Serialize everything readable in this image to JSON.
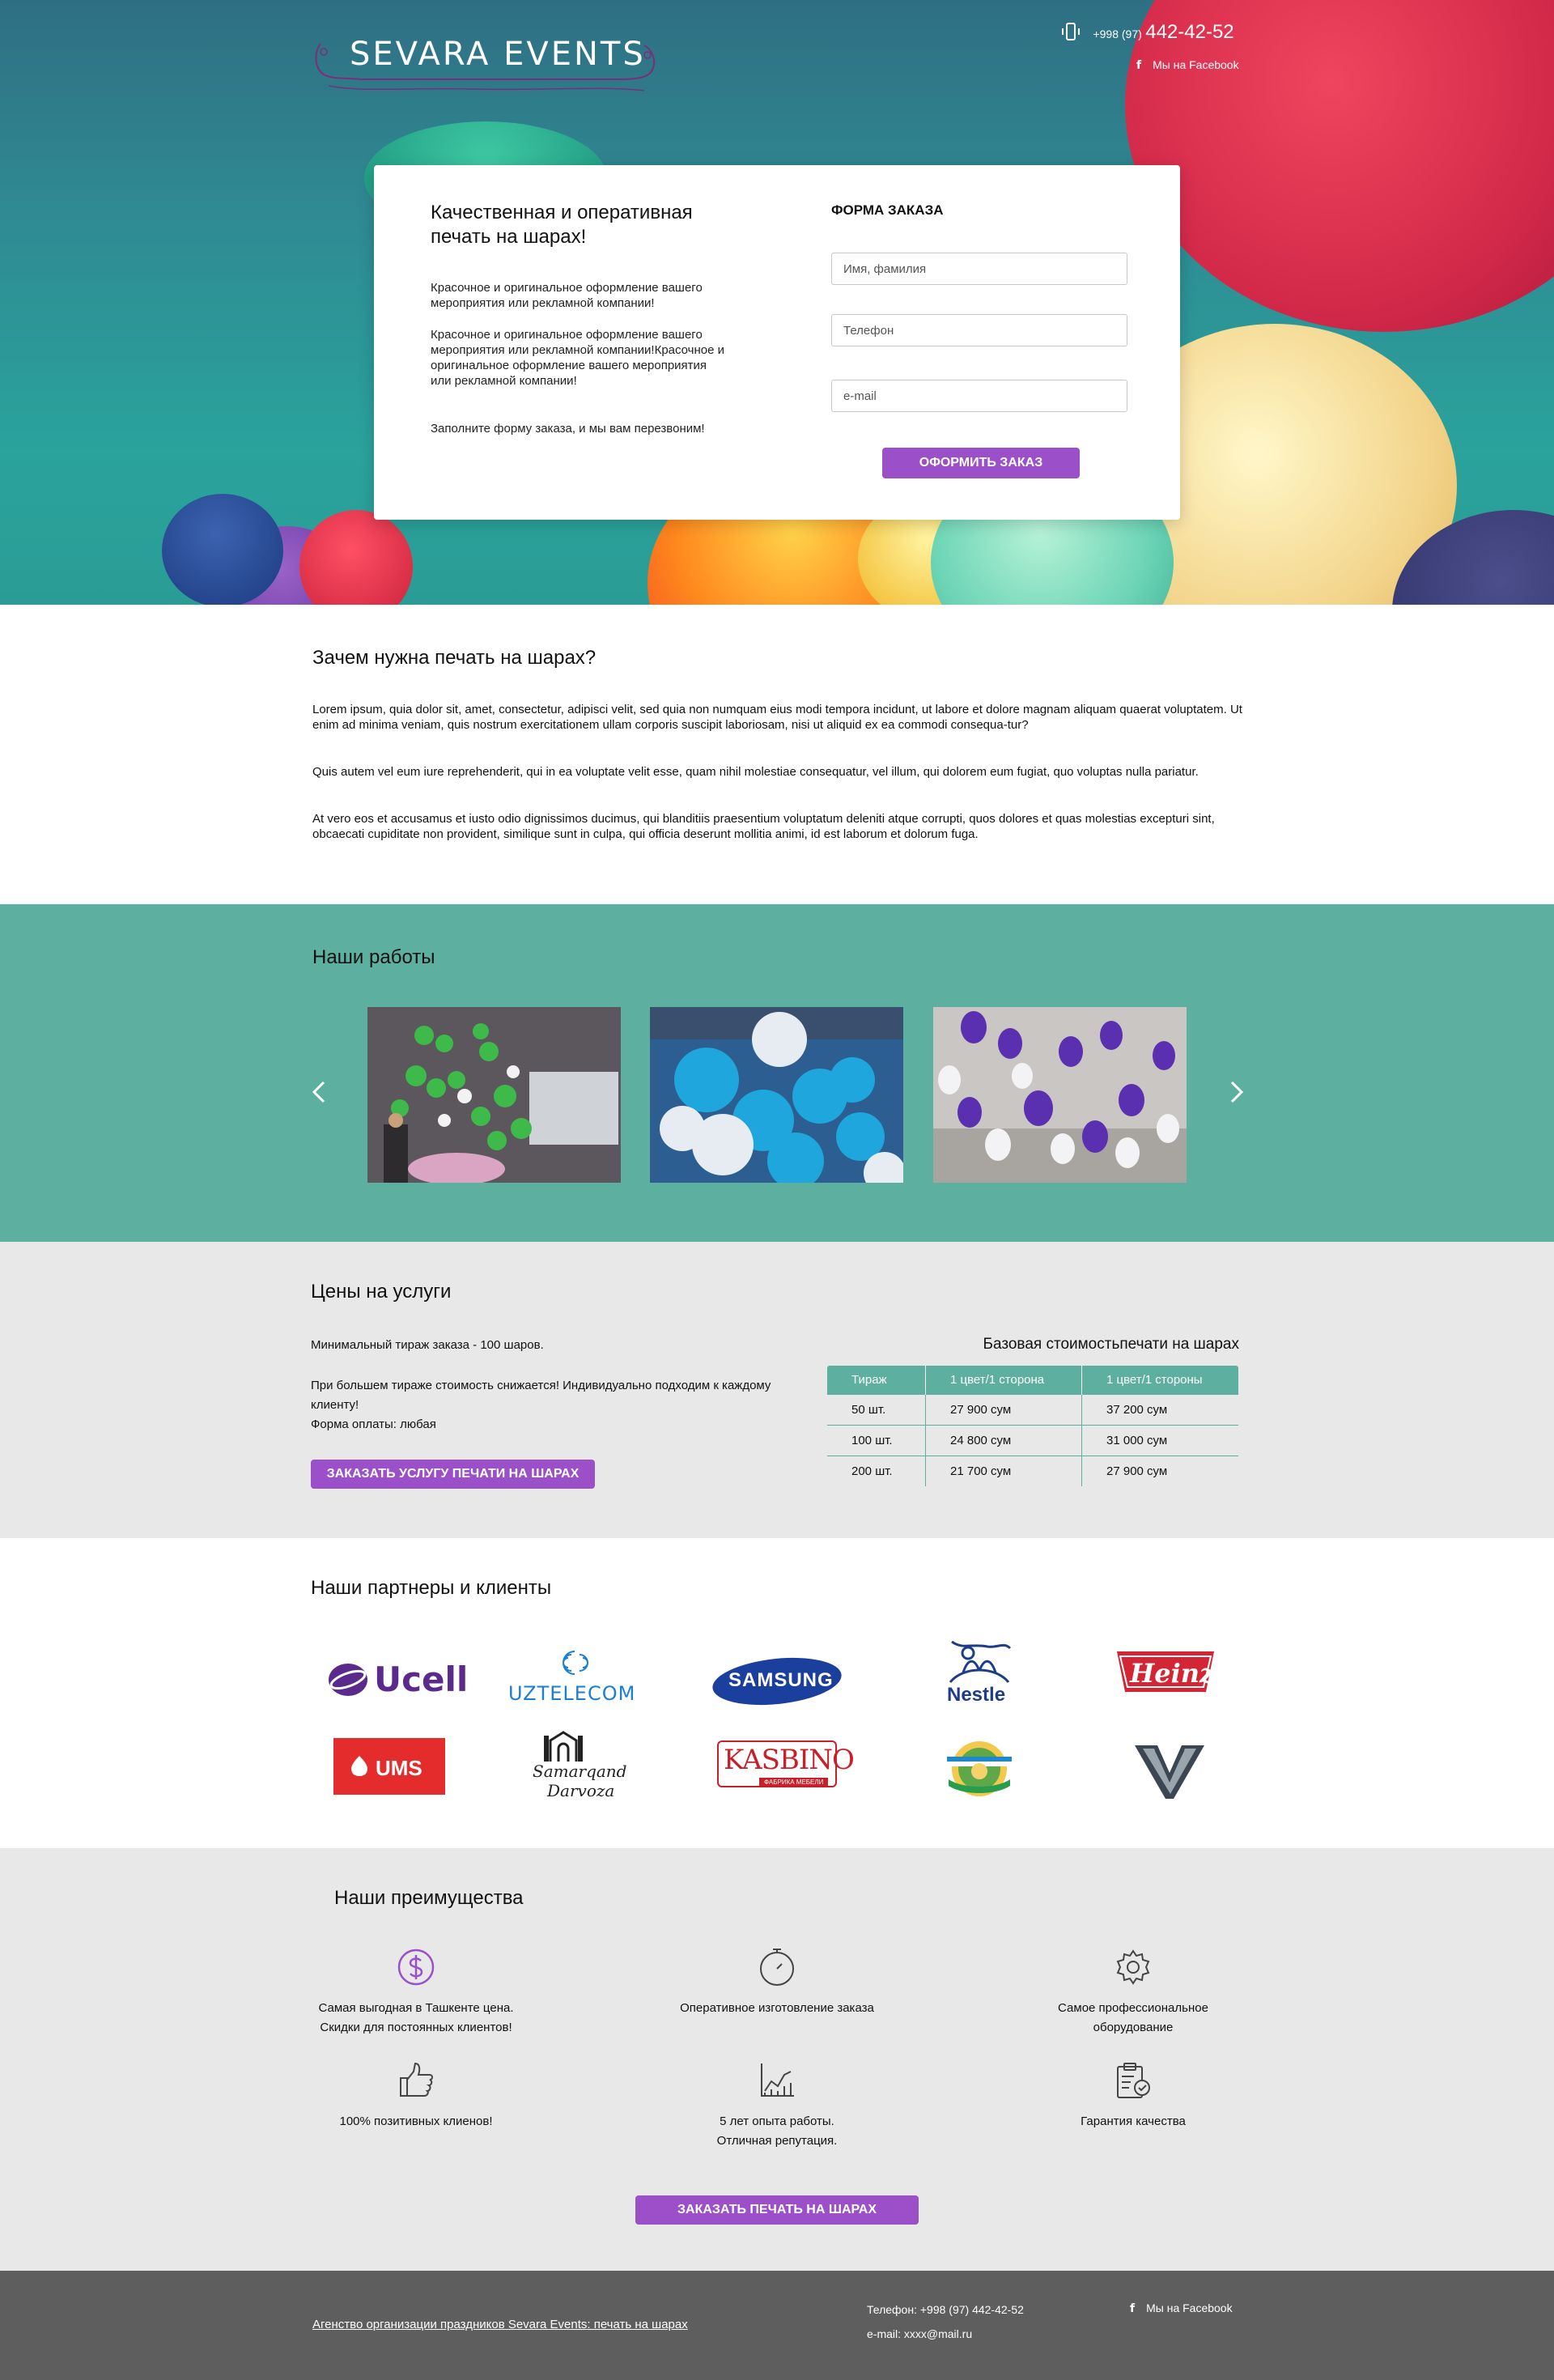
{
  "header": {
    "logo_text": "SEVARA  EVENTS",
    "phone_code": "+998 (97)",
    "phone_number": "442-42-52",
    "facebook_label": "Мы на Facebook"
  },
  "hero": {
    "title": "Качественная и оперативная печать на шарах!",
    "paragraphs": [
      "Красочное и оригинальное оформление вашего мероприятия или рекламной компании!",
      "Красочное и оригинальное оформление вашего мероприятия или рекламной компании!Красочное и оригинальное оформление вашего мероприятия или рекламной компании!",
      "Заполните форму заказа, и мы вам перезвоним!"
    ],
    "form": {
      "title": "ФОРМА ЗАКАЗА",
      "name_placeholder": "Имя, фамилия",
      "phone_placeholder": "Телефон",
      "email_placeholder": "e-mail",
      "submit_label": "ОФОРМИТЬ ЗАКАЗ"
    }
  },
  "why": {
    "title": "Зачем нужна печать на шарах?",
    "paragraphs": [
      "Lorem ipsum, quia dolor sit, amet, consectetur, adipisci velit, sed quia non numquam eius modi tempora incidunt, ut labore et dolore magnam aliquam quaerat voluptatem. Ut enim ad minima veniam, quis nostrum exercitationem ullam corporis suscipit laboriosam, nisi ut aliquid ex ea commodi consequa-tur?",
      "Quis autem vel eum iure reprehenderit, qui in ea voluptate velit esse, quam nihil molestiae consequatur, vel illum, qui dolorem eum fugiat, quo voluptas nulla pariatur.",
      "At vero eos et accusamus et iusto odio dignissimos ducimus, qui blanditiis praesentium voluptatum deleniti atque corrupti, quos dolores et quas molestias excepturi sint, obcaecati cupiditate non provident, similique sunt in culpa, qui officia deserunt mollitia animi, id est laborum et dolorum fuga."
    ]
  },
  "works": {
    "title": "Наши работы",
    "prev_icon": "chevron-left-icon",
    "next_icon": "chevron-right-icon"
  },
  "prices": {
    "title": "Цены на услуги",
    "min_order": "Минимальный тираж заказа - 100 шаров.",
    "discount_line": "При большем тираже стоимость снижается! Индивидуально подходим к каждому клиенту!",
    "payment": "Форма оплаты: любая",
    "order_button": "ЗАКАЗАТЬ УСЛУГУ ПЕЧАТИ НА ШАРАХ",
    "table_title": "Базовая стоимостьпечати на шарах",
    "columns": [
      "Тираж",
      "1 цвет/1 сторона",
      "1 цвет/1 стороны"
    ],
    "rows": [
      [
        "50 шт.",
        "27 900 сум",
        "37 200 сум"
      ],
      [
        "100 шт.",
        "24 800 сум",
        "31 000 сум"
      ],
      [
        "200 шт.",
        "21 700 сум",
        "27 900 сум"
      ]
    ]
  },
  "partners": {
    "title": "Наши партнеры и клиенты",
    "logos": {
      "ucell": "Ucell",
      "uztelecom": "UZTELECOM",
      "samsung": "SAMSUNG",
      "nestle": "Nestle",
      "heinz": "Heinz",
      "ums": "UMS",
      "samarqand_1": "Samarqand",
      "samarqand_2": "Darvoza",
      "kasbino": "KASBINO",
      "kasbino_sub": "ФАБРИКА МЕБЕЛИ"
    }
  },
  "advantages": {
    "title": "Наши преимущества",
    "items": [
      {
        "icon": "dollar-icon",
        "line1": "Самая выгодная в Ташкенте цена.",
        "line2": "Скидки для постоянных клиентов!"
      },
      {
        "icon": "clock-icon",
        "line1": "Оперативное изготовление заказа",
        "line2": ""
      },
      {
        "icon": "gear-icon",
        "line1": "Самое профессиональное",
        "line2": "оборудование"
      },
      {
        "icon": "thumbs-up-icon",
        "line1": "100% позитивных клиенов!",
        "line2": ""
      },
      {
        "icon": "chart-icon",
        "line1": "5 лет опыта работы.",
        "line2": "Отличная репутация."
      },
      {
        "icon": "clipboard-check-icon",
        "line1": "Гарантия качества",
        "line2": ""
      }
    ],
    "order_button": "ЗАКАЗАТЬ ПЕЧАТЬ НА ШАРАХ"
  },
  "footer": {
    "link_text": "Агенство организации праздников Sevara Events: печать на шарах",
    "phone": "Телефон: +998 (97) 442-42-52",
    "email": "e-mail: xxxx@mail.ru",
    "facebook_label": "Мы на Facebook"
  },
  "colors": {
    "accent": "#9b4fc8",
    "teal": "#5db09f",
    "footer": "#5e5e5e",
    "grey_section": "#e8e8e8"
  }
}
